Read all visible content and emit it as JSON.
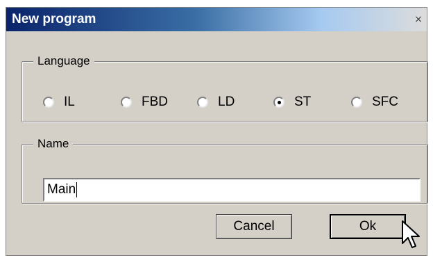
{
  "dialog": {
    "title": "New program",
    "close_glyph": "×"
  },
  "language_group": {
    "legend": "Language",
    "options": [
      {
        "label": "IL",
        "checked": false
      },
      {
        "label": "FBD",
        "checked": false
      },
      {
        "label": "LD",
        "checked": false
      },
      {
        "label": "ST",
        "checked": true
      },
      {
        "label": "SFC",
        "checked": false
      }
    ],
    "selected": "ST"
  },
  "name_group": {
    "legend": "Name",
    "value": "Main"
  },
  "buttons": {
    "cancel_label": "Cancel",
    "ok_label": "Ok"
  },
  "icons": {
    "close": "close-icon",
    "cursor": "mouse-pointer-icon"
  }
}
